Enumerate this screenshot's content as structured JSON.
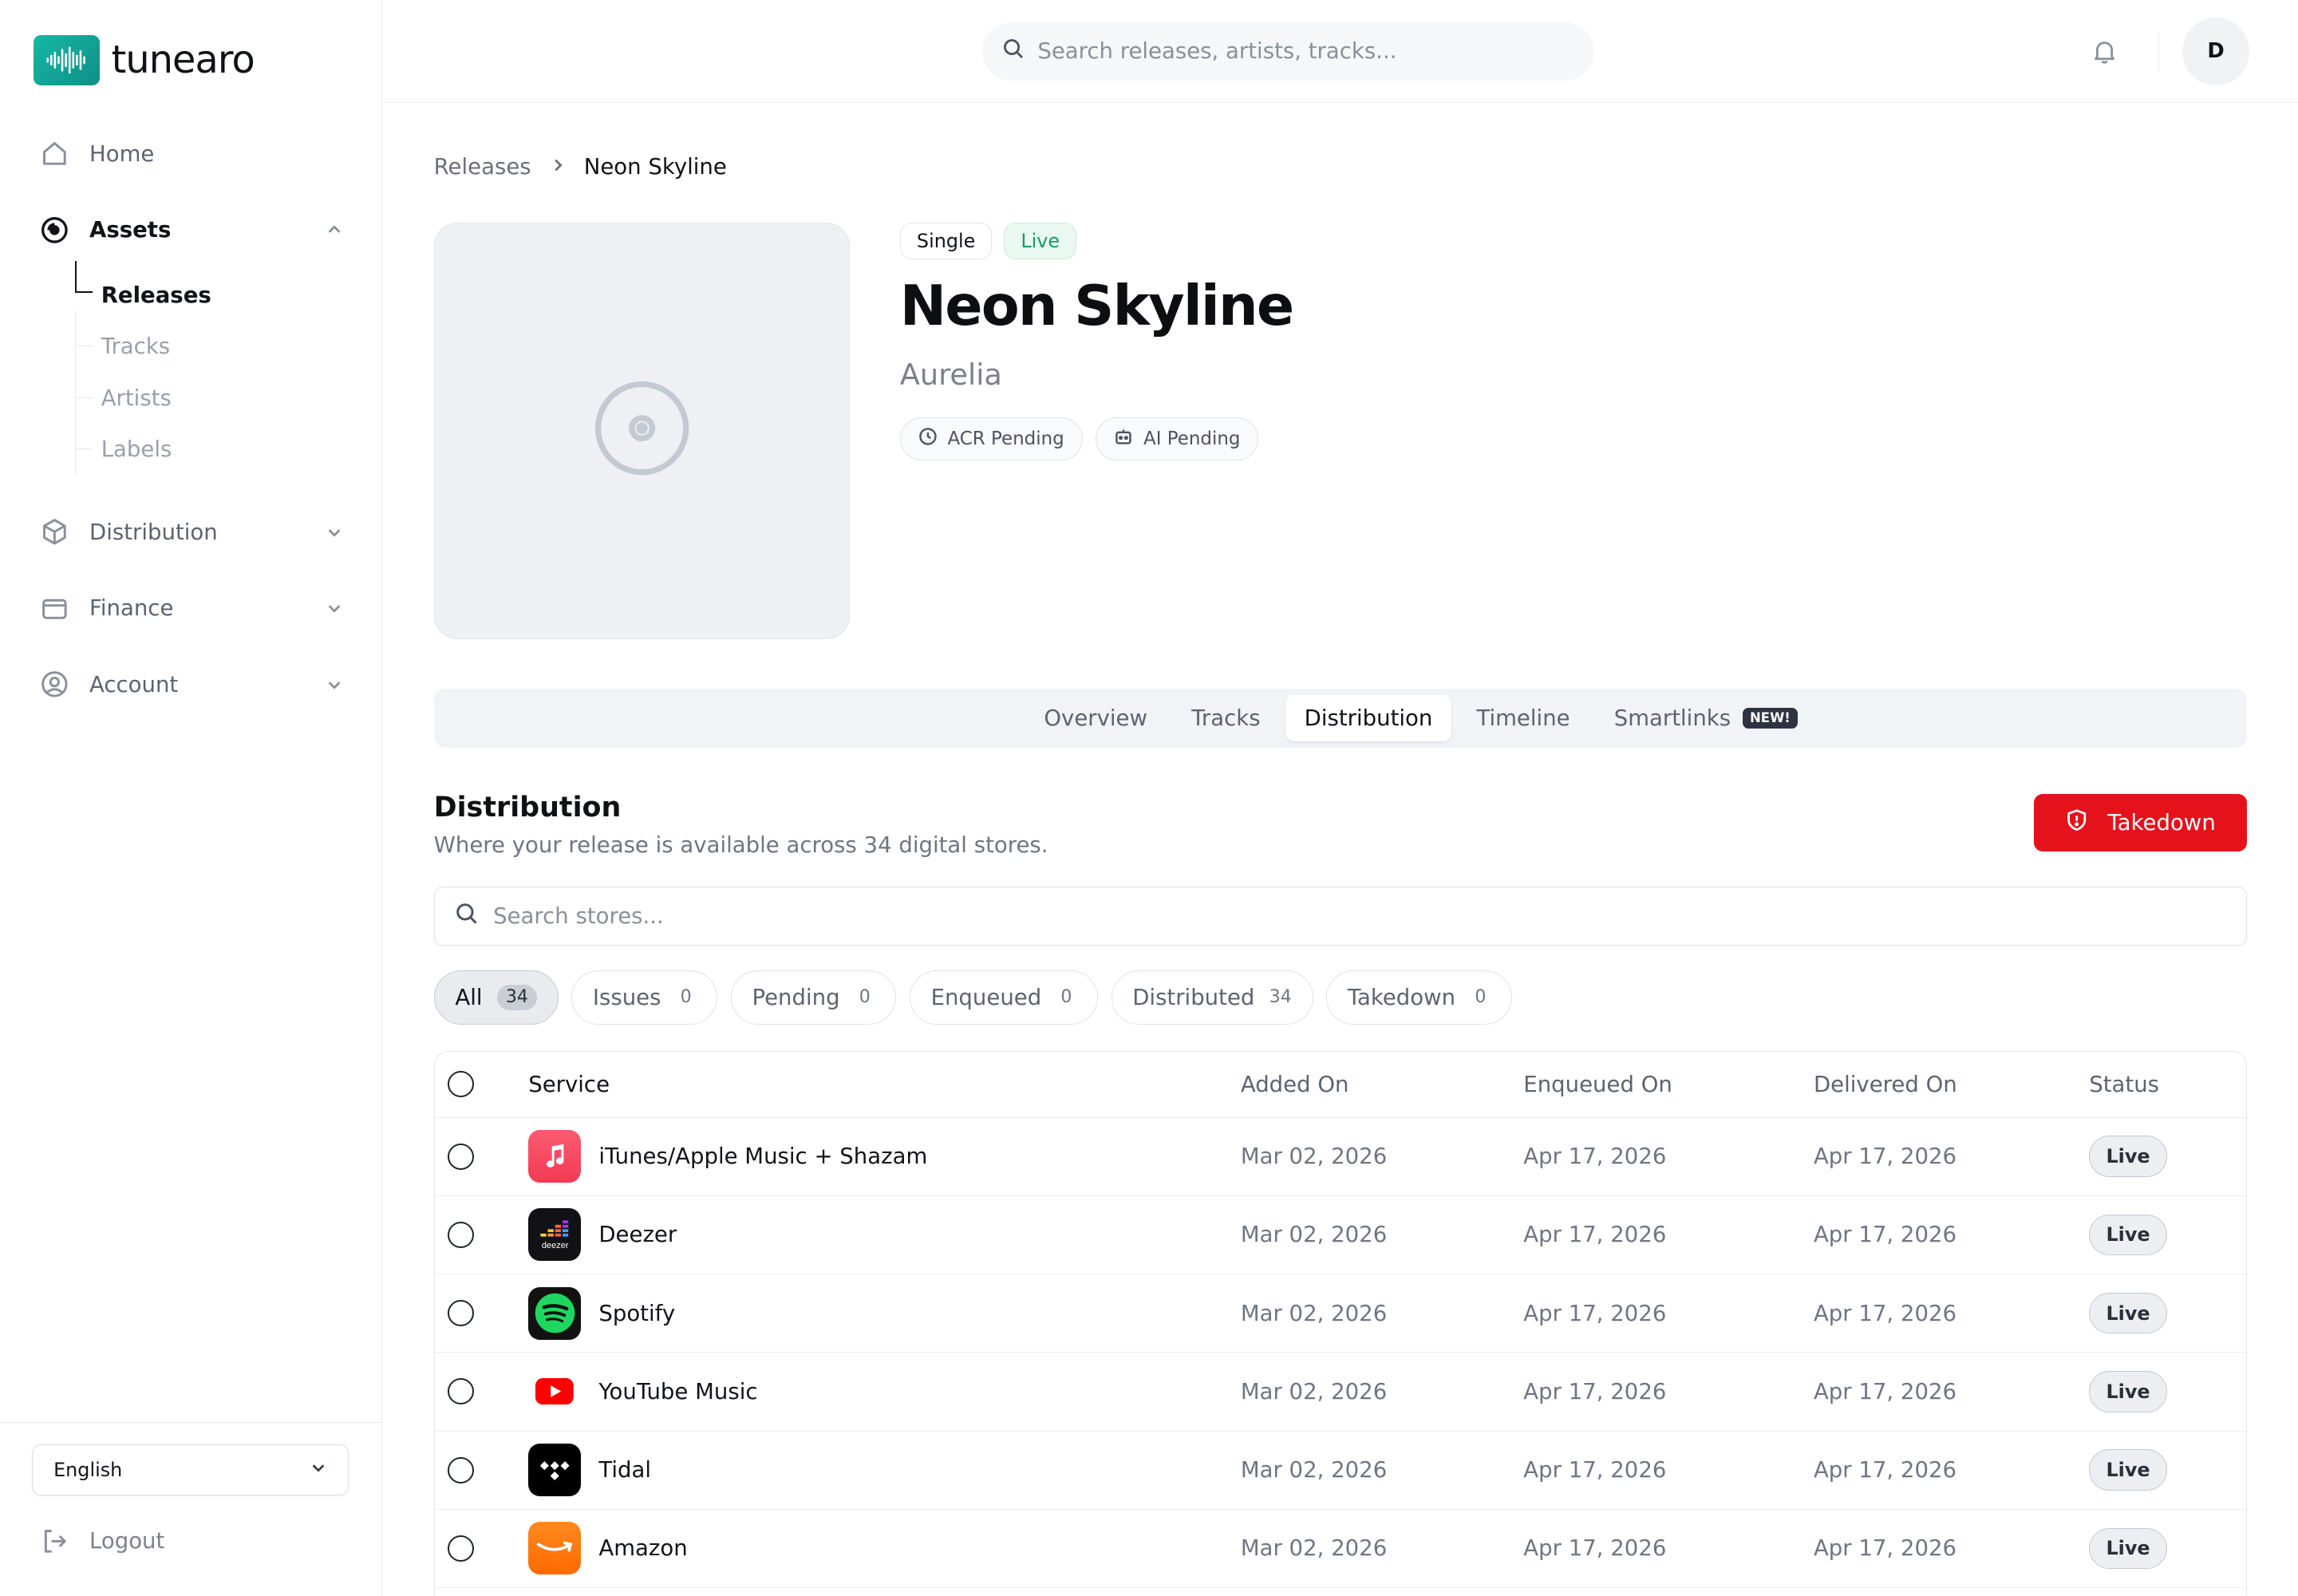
{
  "brand": {
    "name": "tunearo",
    "accent": "#16b9a6"
  },
  "sidebar": {
    "items": [
      {
        "label": "Home",
        "icon": "home-icon"
      },
      {
        "label": "Assets",
        "icon": "disc-icon"
      },
      {
        "label": "Distribution",
        "icon": "package-icon"
      },
      {
        "label": "Finance",
        "icon": "wallet-icon"
      },
      {
        "label": "Account",
        "icon": "user-circle-icon"
      }
    ],
    "assets_sub": [
      "Releases",
      "Tracks",
      "Artists",
      "Labels"
    ],
    "language": "English",
    "logout": "Logout"
  },
  "header": {
    "search_placeholder": "Search releases, artists, tracks...",
    "avatar_initial": "D"
  },
  "breadcrumb": {
    "root": "Releases",
    "current": "Neon Skyline"
  },
  "release": {
    "type": "Single",
    "state": "Live",
    "title": "Neon Skyline",
    "artist": "Aurelia",
    "acr": "ACR Pending",
    "ai": "AI Pending"
  },
  "tabs": [
    "Overview",
    "Tracks",
    "Distribution",
    "Timeline",
    "Smartlinks"
  ],
  "tabs_new_badge": "NEW!",
  "distribution": {
    "title": "Distribution",
    "subtitle": "Where your release is available across 34 digital stores.",
    "takedown_label": "Takedown",
    "takedown_color": "#e5121b",
    "search_placeholder": "Search stores...",
    "filters": [
      {
        "label": "All",
        "count": "34"
      },
      {
        "label": "Issues",
        "count": "0"
      },
      {
        "label": "Pending",
        "count": "0"
      },
      {
        "label": "Enqueued",
        "count": "0"
      },
      {
        "label": "Distributed",
        "count": "34"
      },
      {
        "label": "Takedown",
        "count": "0"
      }
    ],
    "columns": [
      "Service",
      "Added On",
      "Enqueued On",
      "Delivered On",
      "Status"
    ],
    "rows": [
      {
        "service": "iTunes/Apple Music + Shazam",
        "icon": "apple-music-icon",
        "added": "Mar 02, 2026",
        "enqueued": "Apr 17, 2026",
        "delivered": "Apr 17, 2026",
        "status": "Live"
      },
      {
        "service": "Deezer",
        "icon": "deezer-icon",
        "added": "Mar 02, 2026",
        "enqueued": "Apr 17, 2026",
        "delivered": "Apr 17, 2026",
        "status": "Live"
      },
      {
        "service": "Spotify",
        "icon": "spotify-icon",
        "added": "Mar 02, 2026",
        "enqueued": "Apr 17, 2026",
        "delivered": "Apr 17, 2026",
        "status": "Live"
      },
      {
        "service": "YouTube Music",
        "icon": "youtube-icon",
        "added": "Mar 02, 2026",
        "enqueued": "Apr 17, 2026",
        "delivered": "Apr 17, 2026",
        "status": "Live"
      },
      {
        "service": "Tidal",
        "icon": "tidal-icon",
        "added": "Mar 02, 2026",
        "enqueued": "Apr 17, 2026",
        "delivered": "Apr 17, 2026",
        "status": "Live"
      },
      {
        "service": "Amazon",
        "icon": "amazon-icon",
        "added": "Mar 02, 2026",
        "enqueued": "Apr 17, 2026",
        "delivered": "Apr 17, 2026",
        "status": "Live"
      }
    ]
  }
}
